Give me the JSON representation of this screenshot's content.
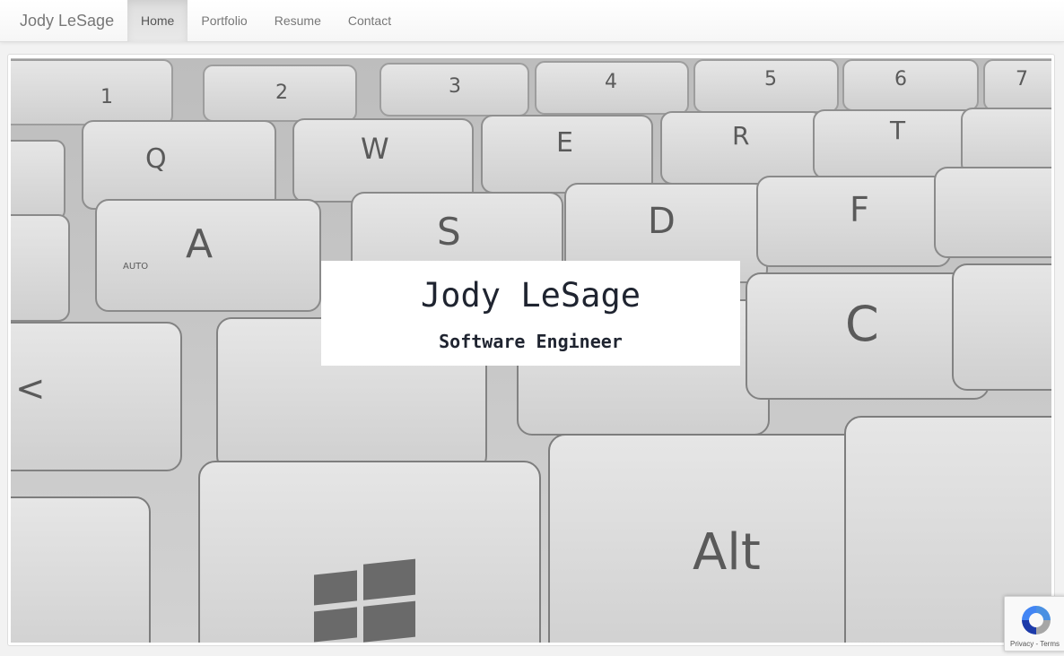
{
  "navbar": {
    "brand": "Jody LeSage",
    "items": [
      {
        "label": "Home",
        "active": true
      },
      {
        "label": "Portfolio",
        "active": false
      },
      {
        "label": "Resume",
        "active": false
      },
      {
        "label": "Contact",
        "active": false
      }
    ]
  },
  "hero": {
    "name": "Jody LeSage",
    "subtitle": "Software Engineer",
    "image": "keyboard-background-image",
    "key_labels": [
      "1",
      "2",
      "3",
      "4",
      "5",
      "6",
      "7",
      "Q",
      "W",
      "E",
      "R",
      "T",
      "A",
      "S",
      "D",
      "F",
      "C",
      "Alt",
      "AUTO"
    ]
  },
  "recaptcha": {
    "privacy": "Privacy",
    "separator": " - ",
    "terms": "Terms",
    "icon": "recaptcha-icon"
  }
}
